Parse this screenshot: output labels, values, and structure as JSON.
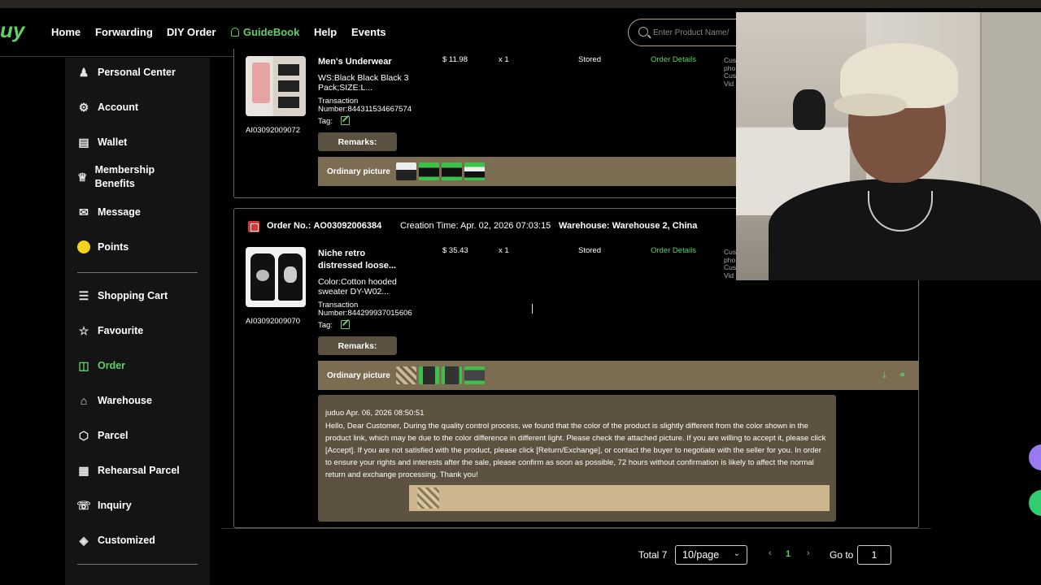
{
  "header": {
    "logo_text": "uy",
    "nav": [
      "Home",
      "Forwarding",
      "DIY Order",
      "GuideBook",
      "Help",
      "Events"
    ],
    "search_placeholder": "Enter Product Name/"
  },
  "sidebar": {
    "items": [
      {
        "label": "Personal Center",
        "icon": "person-icon"
      },
      {
        "label": "Account",
        "icon": "gear-icon"
      },
      {
        "label": "Wallet",
        "icon": "wallet-icon"
      },
      {
        "label": "Membership Benefits",
        "icon": "crown-icon"
      },
      {
        "label": "Message",
        "icon": "message-icon"
      },
      {
        "label": "Points",
        "icon": "points-icon"
      }
    ],
    "items2": [
      {
        "label": "Shopping Cart",
        "icon": "cart-icon"
      },
      {
        "label": "Favourite",
        "icon": "star-icon"
      },
      {
        "label": "Order",
        "icon": "bag-icon",
        "active": true
      },
      {
        "label": "Warehouse",
        "icon": "warehouse-icon"
      },
      {
        "label": "Parcel",
        "icon": "box-icon"
      },
      {
        "label": "Rehearsal Parcel",
        "icon": "rehearsal-icon"
      },
      {
        "label": "Inquiry",
        "icon": "inquiry-icon"
      },
      {
        "label": "Customized",
        "icon": "tag-icon"
      }
    ]
  },
  "orders": [
    {
      "product_name": "Men's Underwear",
      "spec": "WS:Black Black Black 3 Pack;SIZE:L...",
      "transaction_label": "Transaction Number:",
      "transaction_number": "844311534667574",
      "tag_label": "Tag:",
      "item_id": "AI03092009072",
      "price": "$ 11.98",
      "qty": "x 1",
      "status": "Stored",
      "details_link": "Order Details",
      "remarks_label": "Remarks:",
      "ordinary_label": "Ordinary picture"
    },
    {
      "order_no_label": "Order No.:",
      "order_no": "AO03092006384",
      "creation_label": "Creation Time:",
      "creation_time": "Apr. 02, 2026 07:03:15",
      "warehouse_label": "Warehouse:",
      "warehouse": "Warehouse 2, China",
      "product_name": "Niche retro distressed loose...",
      "spec": "Color:Cotton hooded sweater DY-W02...",
      "transaction_label": "Transaction Number:",
      "transaction_number": "844299937015606",
      "tag_label": "Tag:",
      "item_id": "AI03092009070",
      "price": "$ 35.43",
      "qty": "x 1",
      "status": "Stored",
      "details_link": "Order Details",
      "remarks_label": "Remarks:",
      "ordinary_label": "Ordinary picture",
      "qc": {
        "author": "juduo Apr. 06, 2026 08:50:51",
        "message": "Hello, Dear Customer, During the quality control process, we found that the color of the product is slightly different from the color shown in the product link, which may be due to the color difference in different light. Please check the attached picture. If you are willing to accept it, please click [Accept]. If you are not satisfied with the product, please click [Return/Exchange], or contact the buyer to negotiate with the seller for you. In order to ensure your rights and interests after the sale, please confirm as soon as possible, 72 hours without confirmation is likely to affect the normal return and exchange processing. Thank you!"
      }
    }
  ],
  "cut_col_text": [
    "Cus",
    "pho",
    "Cus",
    "Vid"
  ],
  "pagination": {
    "total": "Total 7",
    "page_size": "10/page",
    "current_page": "1",
    "goto_label": "Go to",
    "goto_value": "1"
  },
  "colors": {
    "accent": "#5fd06a",
    "card_tan": "#7a6d52",
    "remarks_bg": "#5b5140"
  }
}
